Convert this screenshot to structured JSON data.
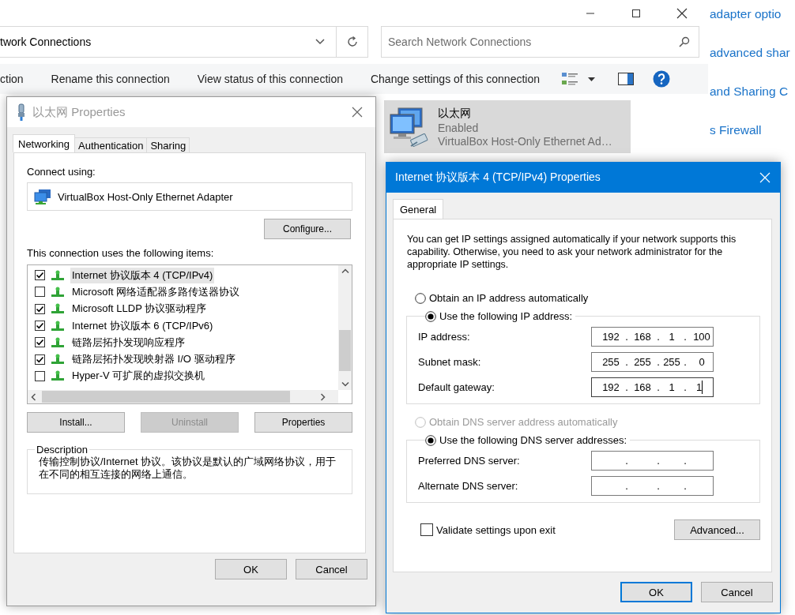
{
  "explorer": {
    "address": "twork Connections",
    "search": {
      "placeholder": "Search Network Connections"
    },
    "toolbar": [
      "ction",
      "Rename this connection",
      "View status of this connection",
      "Change settings of this connection"
    ],
    "connection": {
      "name": "以太网",
      "status": "Enabled",
      "device": "VirtualBox Host-Only Ethernet Ad…",
      "selected": true
    },
    "links": [
      "adapter optio",
      "advanced shar",
      "and Sharing C",
      "s Firewall"
    ]
  },
  "properties_dialog": {
    "title": "以太网 Properties",
    "active": false,
    "tabs": [
      {
        "label": "Networking",
        "selected": true
      },
      {
        "label": "Authentication",
        "selected": false
      },
      {
        "label": "Sharing",
        "selected": false
      }
    ],
    "connect_using_label": "Connect using:",
    "adapter": "VirtualBox Host-Only Ethernet Adapter",
    "configure_button": "Configure...",
    "items_label": "This connection uses the following items:",
    "items": [
      {
        "label": "Internet 协议版本 4 (TCP/IPv4)",
        "checked": true,
        "selected": true
      },
      {
        "label": "Microsoft 网络适配器多路传送器协议",
        "checked": false,
        "selected": false
      },
      {
        "label": "Microsoft LLDP 协议驱动程序",
        "checked": true,
        "selected": false
      },
      {
        "label": "Internet 协议版本 6 (TCP/IPv6)",
        "checked": true,
        "selected": false
      },
      {
        "label": "链路层拓扑发现响应程序",
        "checked": true,
        "selected": false
      },
      {
        "label": "链路层拓扑发现映射器 I/O 驱动程序",
        "checked": true,
        "selected": false
      },
      {
        "label": "Hyper-V 可扩展的虚拟交换机",
        "checked": false,
        "selected": false
      }
    ],
    "buttons": [
      {
        "label": "Install...",
        "disabled": false
      },
      {
        "label": "Uninstall",
        "disabled": true
      },
      {
        "label": "Properties",
        "disabled": false
      }
    ],
    "description": {
      "legend": "Description",
      "text": "传输控制协议/Internet 协议。该协议是默认的广域网络协议，用于在不同的相互连接的网络上通信。"
    },
    "footer_buttons": [
      {
        "label": "OK",
        "default": false
      },
      {
        "label": "Cancel",
        "default": false
      }
    ]
  },
  "ipv4_dialog": {
    "title": "Internet 协议版本 4 (TCP/IPv4) Properties",
    "active": true,
    "tabs": [
      {
        "label": "General",
        "selected": true
      }
    ],
    "intro": "You can get IP settings assigned automatically if your network supports this capability. Otherwise, you need to ask your network administrator for the appropriate IP settings.",
    "ip_options": [
      {
        "label": "Obtain an IP address automatically",
        "selected": false,
        "disabled": false
      },
      {
        "label": "Use the following IP address:",
        "selected": true,
        "disabled": false
      }
    ],
    "ip_fields": [
      {
        "label": "IP address:",
        "octets": [
          "192",
          "168",
          "1",
          "100"
        ],
        "dots": [
          ".",
          ".",
          "."
        ],
        "focused": false
      },
      {
        "label": "Subnet mask:",
        "octets": [
          "255",
          "255",
          "255",
          "0"
        ],
        "dots": [
          ".",
          ".",
          "."
        ],
        "focused": false
      },
      {
        "label": "Default gateway:",
        "octets": [
          "192",
          "168",
          "1",
          "1"
        ],
        "dots": [
          ".",
          ".",
          "."
        ],
        "focused": true
      }
    ],
    "dns_options": [
      {
        "label": "Obtain DNS server address automatically",
        "selected": false,
        "disabled": true
      },
      {
        "label": "Use the following DNS server addresses:",
        "selected": true,
        "disabled": false
      }
    ],
    "dns_fields": [
      {
        "label": "Preferred DNS server:",
        "dots": [
          ".",
          ".",
          "."
        ]
      },
      {
        "label": "Alternate DNS server:",
        "dots": [
          ".",
          ".",
          "."
        ]
      }
    ],
    "validate": {
      "label": "Validate settings upon exit",
      "checked": false
    },
    "advanced_button": "Advanced...",
    "footer_buttons": [
      {
        "label": "OK",
        "default": true
      },
      {
        "label": "Cancel",
        "default": false
      }
    ]
  }
}
